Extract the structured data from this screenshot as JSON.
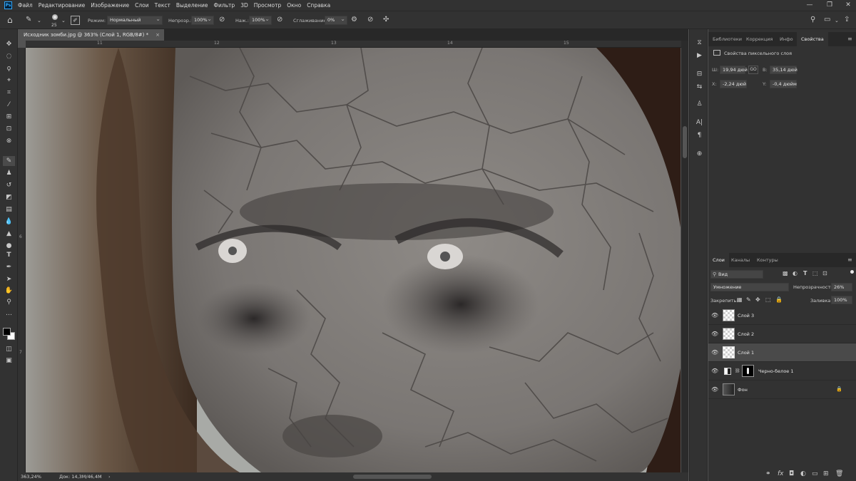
{
  "menu": {
    "logo": "Ps",
    "items": [
      "Файл",
      "Редактирование",
      "Изображение",
      "Слои",
      "Текст",
      "Выделение",
      "Фильтр",
      "3D",
      "Просмотр",
      "Окно",
      "Справка"
    ]
  },
  "options": {
    "brush_size": "25",
    "mode_label": "Режим:",
    "mode_value": "Нормальный",
    "opacity_label": "Непрозр.:",
    "opacity_value": "100%",
    "flow_label": "Наж.:",
    "flow_value": "100%",
    "smoothing_label": "Сглаживание:",
    "smoothing_value": "0%"
  },
  "document": {
    "tab_title": "Исходник зомби.jpg @ 363% (Слой 1, RGB/8#) *",
    "close_glyph": "×",
    "zoom": "363,24%",
    "doc_size": "Док: 14,3M/46,4M",
    "ruler_h": [
      "11",
      "12",
      "13",
      "14",
      "15"
    ],
    "ruler_v": [
      "6",
      "7"
    ]
  },
  "properties": {
    "tabs": [
      "Библиотеки",
      "Коррекция",
      "Инфо",
      "Свойства"
    ],
    "active_tab": 3,
    "header": "Свойства пиксельного слоя",
    "w_label": "Ш:",
    "w_value": "19,94 дюй",
    "link_glyph": "GO",
    "h_label": "В:",
    "h_value": "35,14 дюй",
    "x_label": "X:",
    "x_value": "-2,24 дюй",
    "y_label": "Y:",
    "y_value": "-0,4 дюйм"
  },
  "layers_panel": {
    "tabs": [
      "Слои",
      "Каналы",
      "Контуры"
    ],
    "active_tab": 0,
    "filter_value": "Вид",
    "blend_mode": "Умножение",
    "opacity_label": "Непрозрачность:",
    "opacity_value": "26%",
    "lock_label": "Закрепить:",
    "fill_label": "Заливка:",
    "fill_value": "100%",
    "layers": [
      {
        "name": "Слой 3",
        "selected": false
      },
      {
        "name": "Слой 2",
        "selected": false
      },
      {
        "name": "Слой 1",
        "selected": true
      },
      {
        "name": "Черно-белое 1",
        "selected": false
      },
      {
        "name": "Фон",
        "selected": false
      }
    ]
  },
  "colors": {
    "accent": "#31a8ff",
    "panel_bg": "#323232",
    "selected_layer": "#4a4a4a"
  }
}
